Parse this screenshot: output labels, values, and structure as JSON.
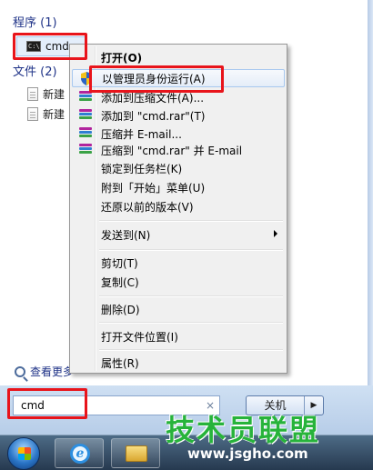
{
  "start_menu": {
    "programs_header": "程序 (1)",
    "files_header": "文件 (2)",
    "program_item": "cmd",
    "file_items": [
      "新建",
      "新建"
    ],
    "see_more": "查看更多"
  },
  "search": {
    "value": "cmd",
    "clear_symbol": "×"
  },
  "shutdown": {
    "label": "关机",
    "arrow": "▶"
  },
  "context_menu": {
    "items": [
      {
        "label": "打开(O)",
        "bold": true
      },
      {
        "label": "以管理员身份运行(A)",
        "icon": "shield-icon",
        "highlighted": true
      },
      {
        "label": "添加到压缩文件(A)...",
        "icon": "winrar-icon"
      },
      {
        "label": "添加到 \"cmd.rar\"(T)",
        "icon": "winrar-icon"
      },
      {
        "label": "压缩并 E-mail...",
        "icon": "winrar-icon"
      },
      {
        "label": "压缩到 \"cmd.rar\" 并 E-mail",
        "icon": "winrar-icon"
      },
      {
        "label": "锁定到任务栏(K)"
      },
      {
        "label": "附到「开始」菜单(U)"
      },
      {
        "label": "还原以前的版本(V)"
      },
      {
        "label": "发送到(N)",
        "submenu": true
      },
      {
        "label": "剪切(T)"
      },
      {
        "label": "复制(C)"
      },
      {
        "label": "删除(D)"
      },
      {
        "label": "打开文件位置(I)"
      },
      {
        "label": "属性(R)"
      }
    ]
  },
  "watermark": {
    "brand": "技术员联盟",
    "url": "www.jsgho.com"
  },
  "colors": {
    "annotation_red": "#e8141b",
    "watermark_green": "#27b33b",
    "header_blue": "#1e3287"
  }
}
